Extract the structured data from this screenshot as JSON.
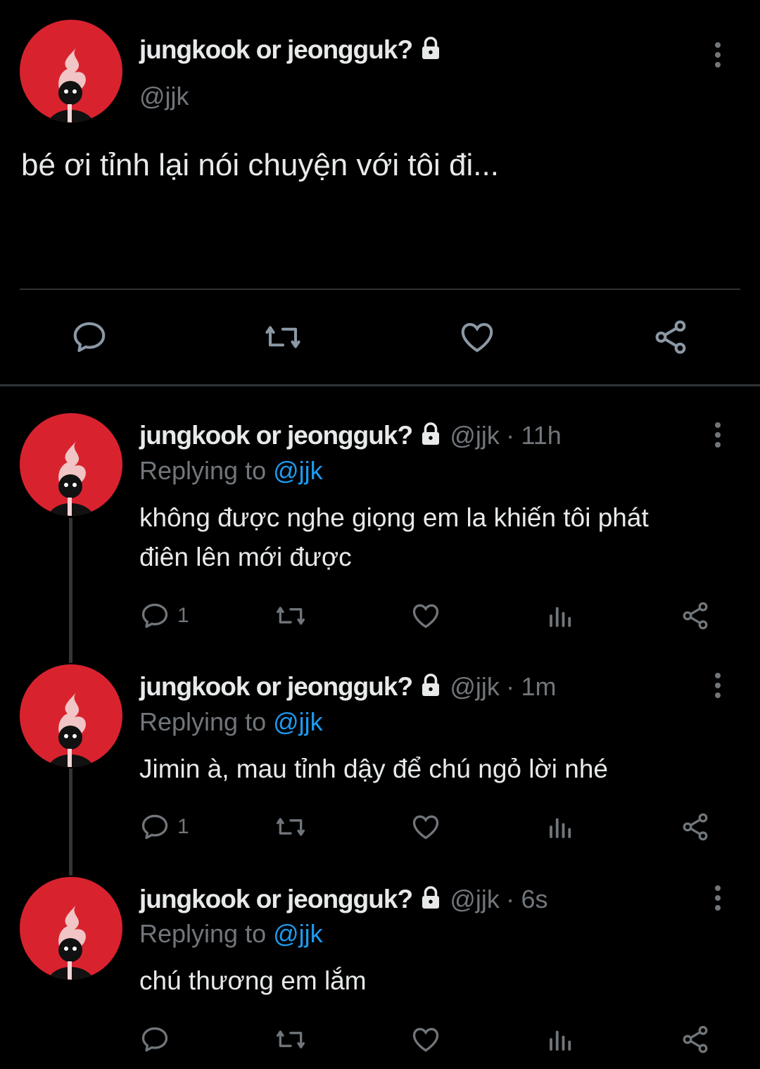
{
  "main_tweet": {
    "display_name": "jungkook or jeongguk?",
    "handle": "@jjk",
    "text": "bé ơi tỉnh lại nói chuyện với tôi đi..."
  },
  "replies": [
    {
      "display_name": "jungkook or jeongguk?",
      "handle": "@jjk",
      "sep": "·",
      "time": "11h",
      "replying_prefix": "Replying to ",
      "replying_handle": "@jjk",
      "text": "không được nghe giọng em la khiến tôi phát điên lên mới được",
      "reply_count": "1"
    },
    {
      "display_name": "jungkook or jeongguk?",
      "handle": "@jjk",
      "sep": "·",
      "time": "1m",
      "replying_prefix": "Replying to ",
      "replying_handle": "@jjk",
      "text": "Jimin à, mau tỉnh dậy để chú ngỏ lời nhé",
      "reply_count": "1"
    },
    {
      "display_name": "jungkook or jeongguk?",
      "handle": "@jjk",
      "sep": "·",
      "time": "6s",
      "replying_prefix": "Replying to ",
      "replying_handle": "@jjk",
      "text": "chú thương em lắm",
      "reply_count": ""
    }
  ],
  "colors": {
    "background": "#000000",
    "avatar": "#d8232f",
    "mention": "#1d9bf0",
    "muted": "#71767b"
  }
}
